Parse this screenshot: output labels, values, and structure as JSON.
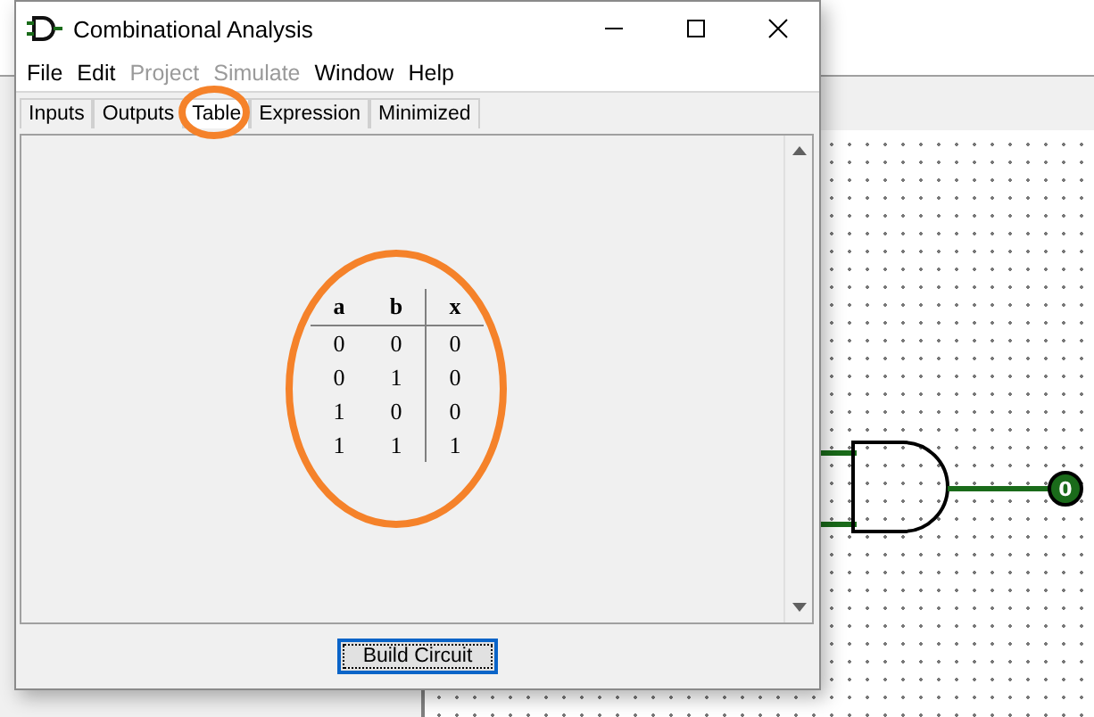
{
  "window": {
    "title": "Combinational Analysis"
  },
  "menu": [
    {
      "label": "File",
      "disabled": false
    },
    {
      "label": "Edit",
      "disabled": false
    },
    {
      "label": "Project",
      "disabled": true
    },
    {
      "label": "Simulate",
      "disabled": true
    },
    {
      "label": "Window",
      "disabled": false
    },
    {
      "label": "Help",
      "disabled": false
    }
  ],
  "tabs": [
    {
      "label": "Inputs",
      "selected": false
    },
    {
      "label": "Outputs",
      "selected": false
    },
    {
      "label": "Table",
      "selected": true
    },
    {
      "label": "Expression",
      "selected": false
    },
    {
      "label": "Minimized",
      "selected": false
    }
  ],
  "truth_table": {
    "columns": [
      {
        "label": "a",
        "kind": "input"
      },
      {
        "label": "b",
        "kind": "input"
      },
      {
        "label": "x",
        "kind": "output"
      }
    ],
    "rows": [
      [
        "0",
        "0",
        "0"
      ],
      [
        "0",
        "1",
        "0"
      ],
      [
        "1",
        "0",
        "0"
      ],
      [
        "1",
        "1",
        "1"
      ]
    ]
  },
  "buttons": [
    "Build Circuit"
  ],
  "circuit": {
    "output_value": "0"
  }
}
